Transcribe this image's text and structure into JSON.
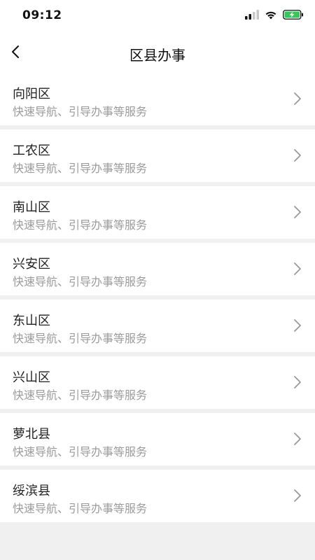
{
  "status_bar": {
    "time": "09:12",
    "signal_icon": "signal-bars-icon",
    "wifi_icon": "wifi-icon",
    "battery_icon": "battery-charging-icon",
    "battery_color": "#34c759"
  },
  "header": {
    "title": "区县办事",
    "back_icon": "chevron-left-icon"
  },
  "items": [
    {
      "title": "向阳区",
      "subtitle": "快速导航、引导办事等服务"
    },
    {
      "title": "工农区",
      "subtitle": "快速导航、引导办事等服务"
    },
    {
      "title": "南山区",
      "subtitle": "快速导航、引导办事等服务"
    },
    {
      "title": "兴安区",
      "subtitle": "快速导航、引导办事等服务"
    },
    {
      "title": "东山区",
      "subtitle": "快速导航、引导办事等服务"
    },
    {
      "title": "兴山区",
      "subtitle": "快速导航、引导办事等服务"
    },
    {
      "title": "萝北县",
      "subtitle": "快速导航、引导办事等服务"
    },
    {
      "title": "绥滨县",
      "subtitle": "快速导航、引导办事等服务"
    }
  ]
}
